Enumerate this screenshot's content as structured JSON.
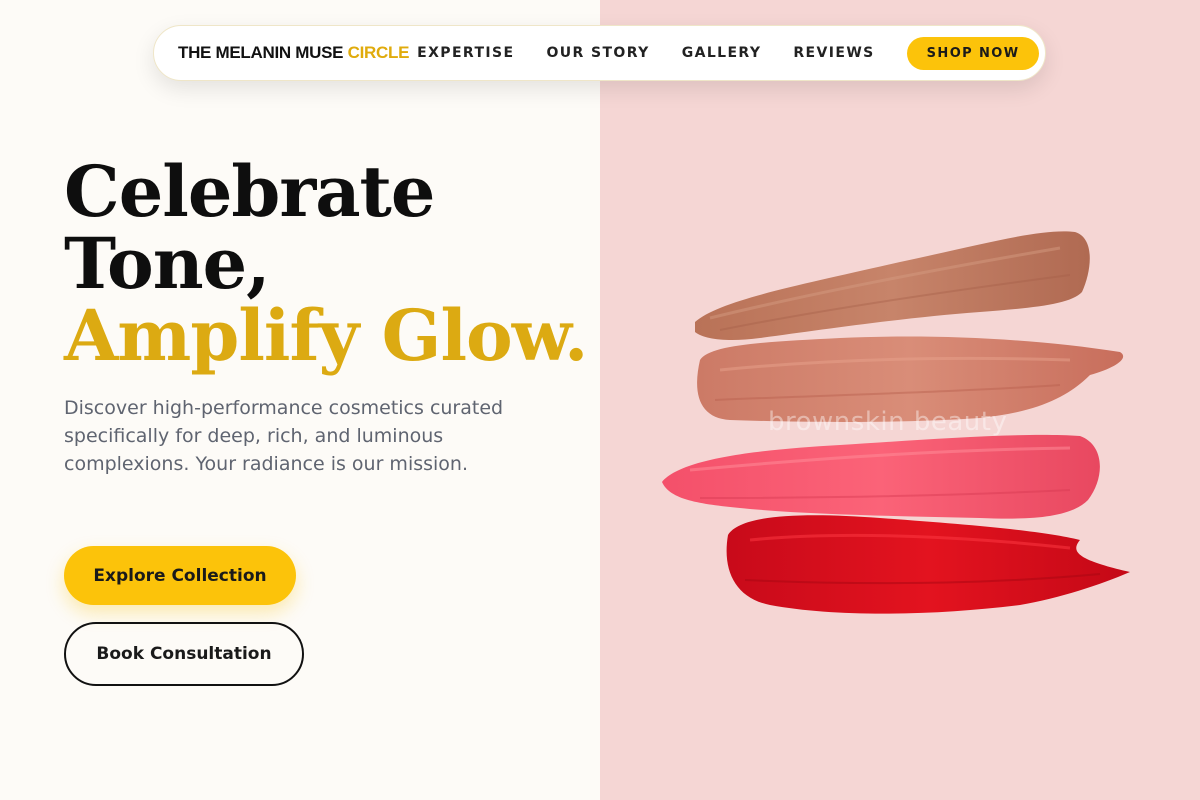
{
  "nav": {
    "brand_main": "THE MELANIN MUSE",
    "brand_accent": "CIRCLE",
    "links": [
      {
        "label": "EXPERTISE"
      },
      {
        "label": "OUR STORY"
      },
      {
        "label": "GALLERY"
      },
      {
        "label": "REVIEWS"
      }
    ],
    "cta_label": "SHOP NOW"
  },
  "hero": {
    "headline_line1": "Celebrate",
    "headline_line2": "Tone,",
    "headline_line3": "Amplify Glow.",
    "subtitle": "Discover high-performance cosmetics curated specifically for deep, rich, and luminous complexions. Your radiance is our mission.",
    "primary_button": "Explore Collection",
    "secondary_button": "Book Consultation"
  },
  "image": {
    "watermark": "brownskin beauty",
    "swatch_colors": [
      "#c27b62",
      "#d4806c",
      "#f04d63",
      "#de1020"
    ]
  },
  "colors": {
    "accent_yellow": "#fcc30a",
    "gold_text": "#dcaa12",
    "panel_pink": "#f5d6d4",
    "panel_cream": "#fdfbf7"
  }
}
